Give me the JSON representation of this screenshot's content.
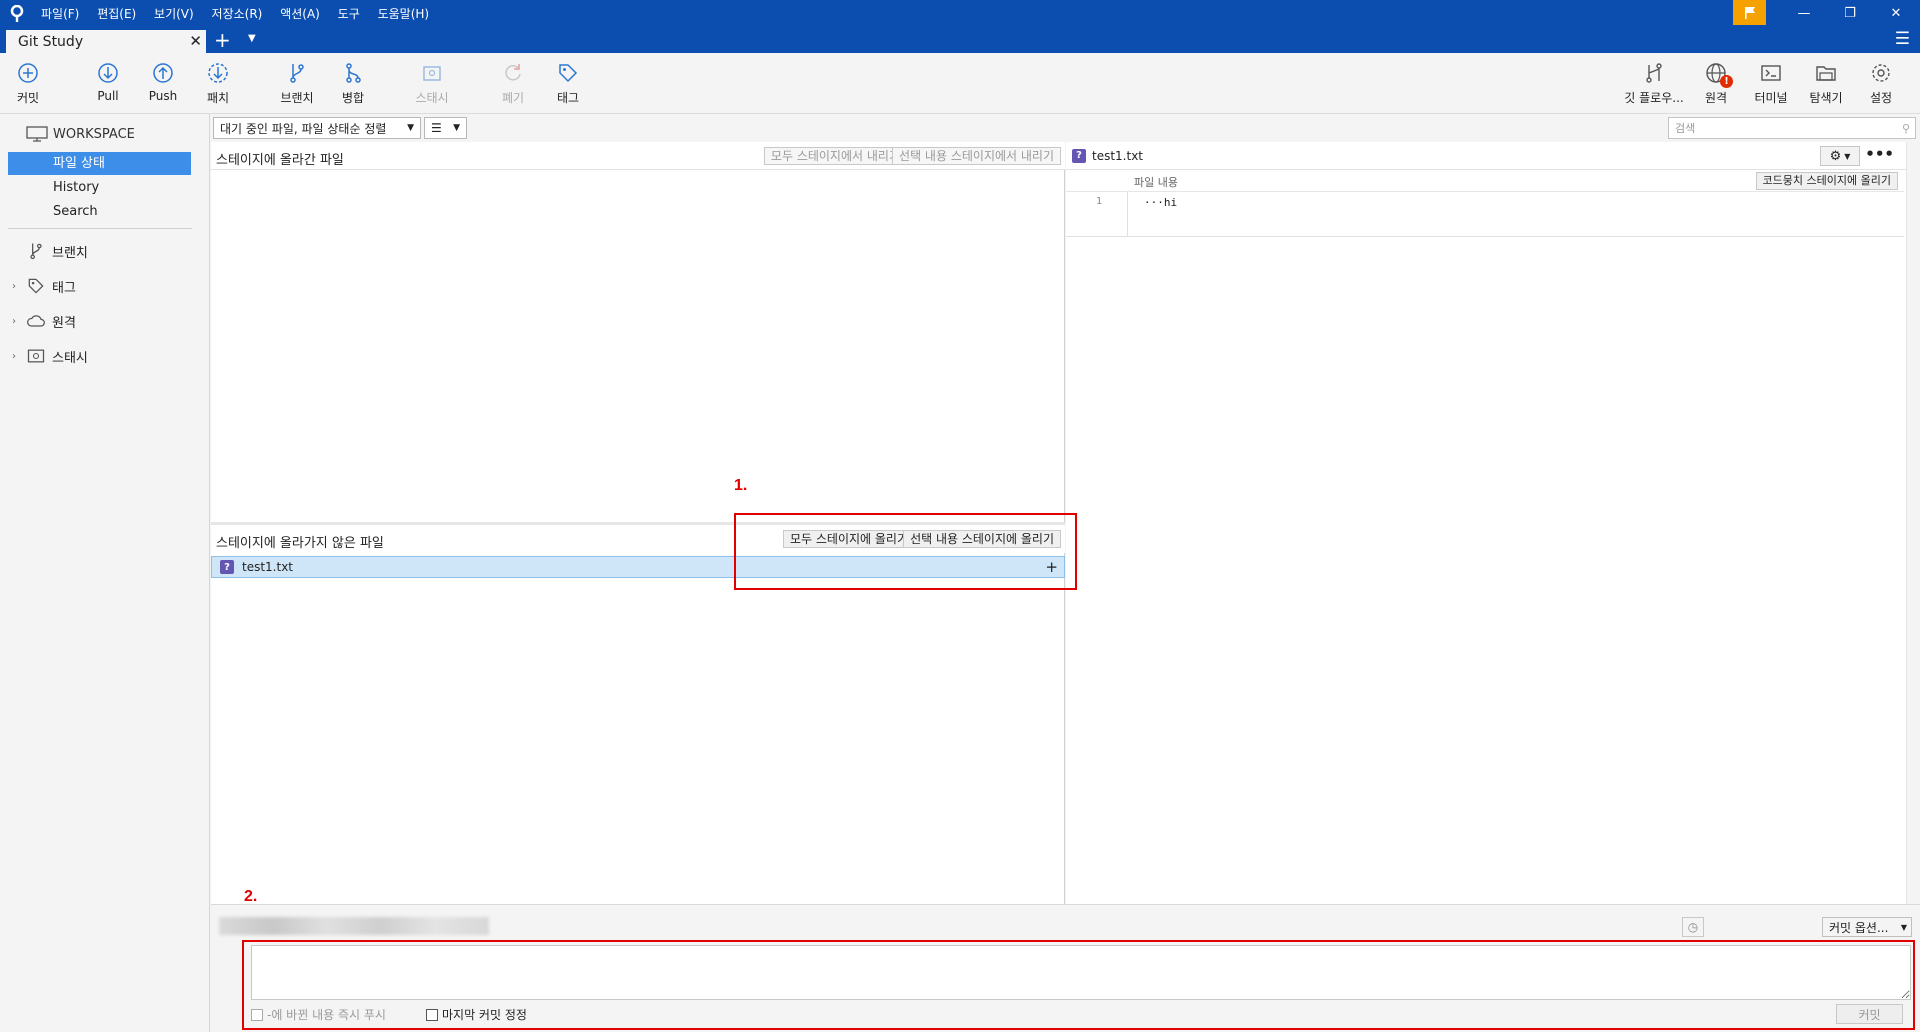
{
  "menu": [
    "파일(F)",
    "편집(E)",
    "보기(V)",
    "저장소(R)",
    "액션(A)",
    "도구",
    "도움말(H)"
  ],
  "tab": {
    "title": "Git Study"
  },
  "toolbar": {
    "commit": "커밋",
    "pull": "Pull",
    "push": "Push",
    "fetch": "패치",
    "branch": "브랜치",
    "merge": "병합",
    "stash": "스태시",
    "discard": "폐기",
    "tag": "태그",
    "gitflow": "깃 플로우...",
    "remote": "원격",
    "remote_badge": "!",
    "terminal": "터미널",
    "explorer": "탐색기",
    "settings": "설정"
  },
  "sidebar": {
    "workspace": "WORKSPACE",
    "items": [
      "파일 상태",
      "History",
      "Search"
    ],
    "sections": [
      "브랜치",
      "태그",
      "원격",
      "스태시"
    ]
  },
  "filter": {
    "sort": "대기 중인 파일, 파일 상태순 정렬",
    "view": "☰",
    "search_placeholder": "검색"
  },
  "staged": {
    "title": "스테이지에 올라간 파일",
    "unstage_all": "모두 스테이지에서 내리기",
    "unstage_selected": "선택 내용 스테이지에서 내리기"
  },
  "unstaged": {
    "title": "스테이지에 올라가지 않은 파일",
    "stage_all": "모두 스테이지에 올리기",
    "stage_selected": "선택 내용 스테이지에 올리기",
    "files": [
      {
        "name": "test1.txt",
        "status": "?"
      }
    ]
  },
  "diff": {
    "file": "test1.txt",
    "hunk_title": "파일 내용",
    "stage_hunk": "코드뭉치 스테이지에 올리기",
    "line_no": "1",
    "line": "···hi"
  },
  "commit": {
    "options": "커밋 옵션...",
    "push_immediately": "-에 바뀐 내용 즉시 푸시",
    "amend": "마지막 커밋 정정",
    "button": "커밋"
  },
  "annotations": {
    "label1": "1.",
    "label2": "2.",
    "color": "#e00000"
  },
  "colors": {
    "titlebar": "#0b4eb0",
    "selection": "#3d8ee8",
    "flag": "#f5a200"
  }
}
